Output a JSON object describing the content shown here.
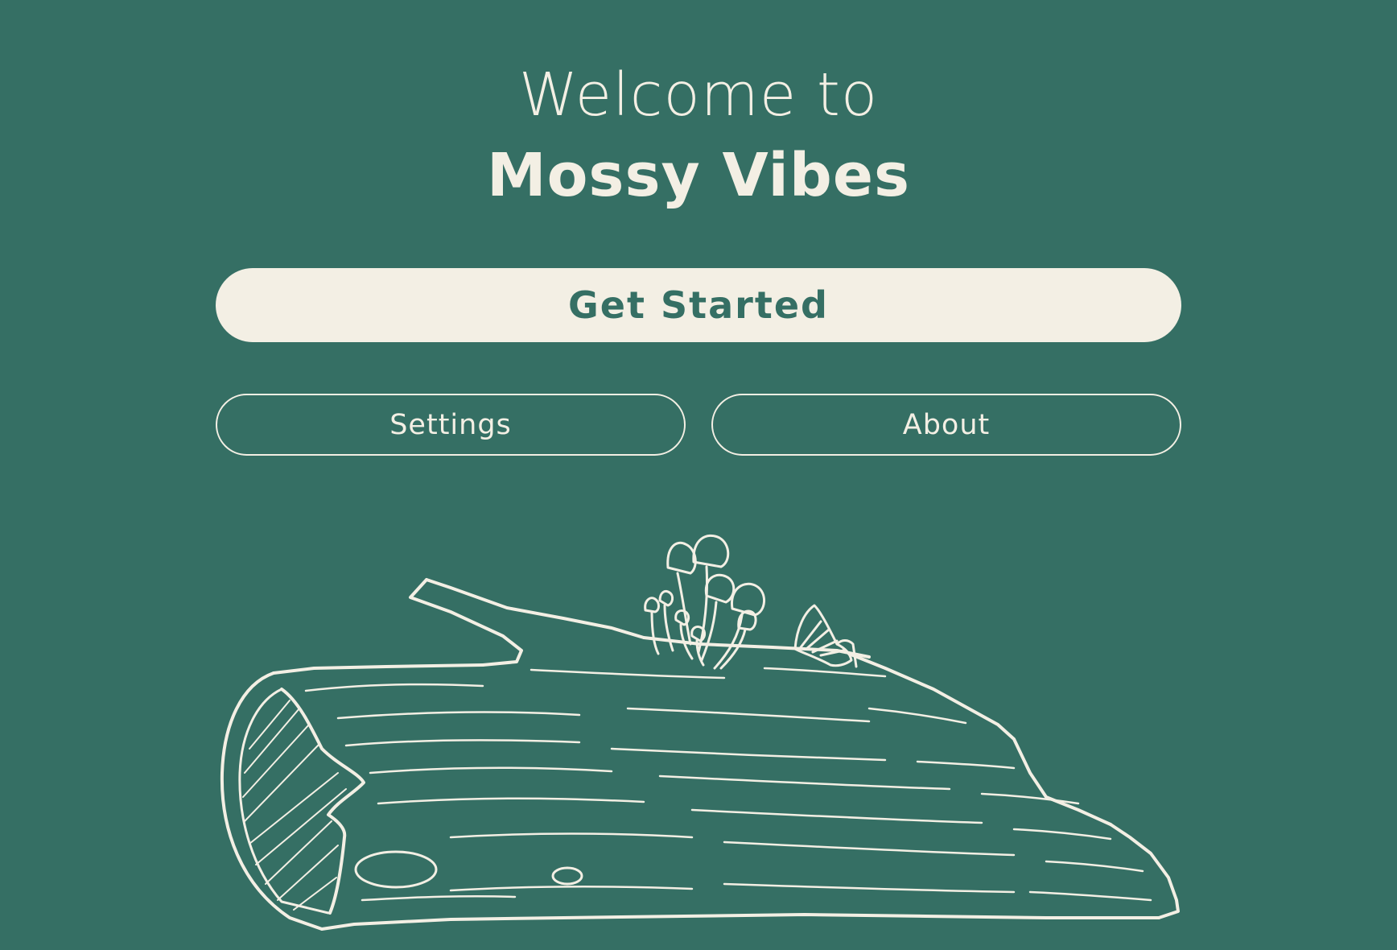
{
  "header": {
    "welcome": "Welcome to",
    "app_name": "Mossy Vibes"
  },
  "actions": {
    "get_started_label": "Get Started",
    "settings_label": "Settings",
    "about_label": "About"
  },
  "theme": {
    "background": "#356F64",
    "foreground": "#F3EFE4"
  },
  "illustration": {
    "icon": "mossy-log-with-mushrooms-icon"
  }
}
